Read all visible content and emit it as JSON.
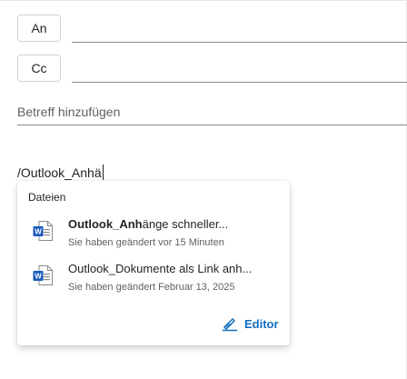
{
  "recipients": {
    "to_label": "An",
    "cc_label": "Cc"
  },
  "subject": {
    "placeholder": "Betreff hinzufügen"
  },
  "body": {
    "typed_text": "/Outlook_Anhä"
  },
  "suggestions": {
    "heading": "Dateien",
    "files": [
      {
        "title_match": "Outlook_Anh",
        "title_rest": "änge schneller...",
        "subtitle": "Sie haben geändert vor 15 Minuten",
        "icon": "word-document-icon"
      },
      {
        "title_match": "",
        "title_rest": "Outlook_Dokumente als Link anh...",
        "subtitle": "Sie haben geändert Februar 13, 2025",
        "icon": "word-document-icon"
      }
    ],
    "editor_label": "Editor"
  },
  "colors": {
    "accent": "#0f6cbd",
    "word_blue": "#185abd"
  }
}
